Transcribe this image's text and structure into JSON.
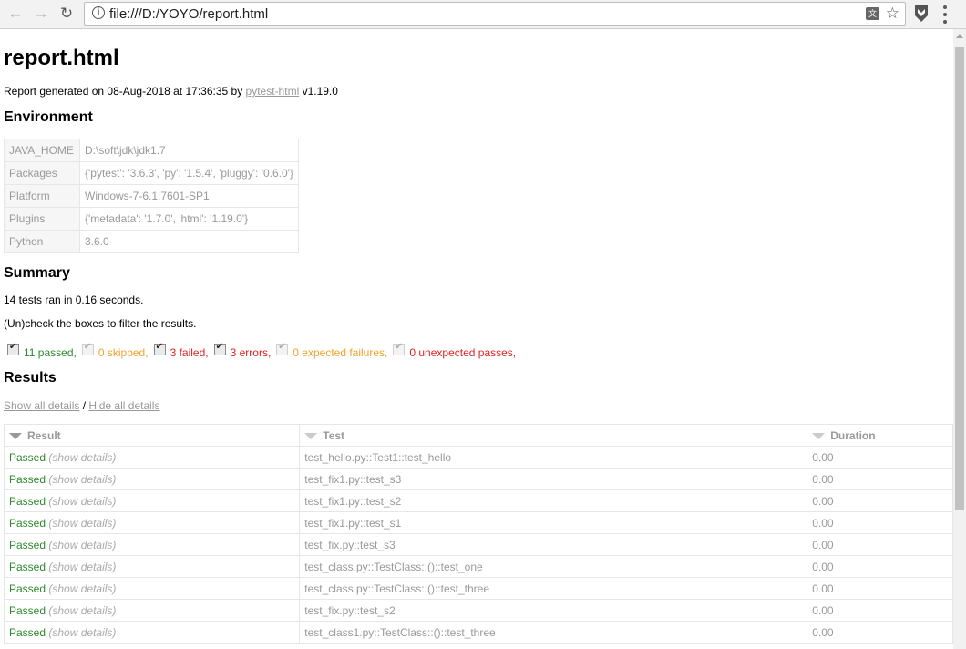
{
  "browser": {
    "url": "file:///D:/YOYO/report.html",
    "icons": [
      "back-icon",
      "forward-icon",
      "reload-icon",
      "info-icon",
      "translate-icon",
      "star-icon",
      "extension-icon",
      "menu-icon"
    ]
  },
  "report": {
    "title": "report.html",
    "generated_prefix": "Report generated on 08-Aug-2018 at 17:36:35 by",
    "generated_link": "pytest-html",
    "generated_suffix": "v1.19.0"
  },
  "environment": {
    "heading": "Environment",
    "rows": [
      {
        "key": "JAVA_HOME",
        "value": "D:\\soft\\jdk\\jdk1.7"
      },
      {
        "key": "Packages",
        "value": "{'pytest': '3.6.3', 'py': '1.5.4', 'pluggy': '0.6.0'}"
      },
      {
        "key": "Platform",
        "value": "Windows-7-6.1.7601-SP1"
      },
      {
        "key": "Plugins",
        "value": "{'metadata': '1.7.0', 'html': '1.19.0'}"
      },
      {
        "key": "Python",
        "value": "3.6.0"
      }
    ]
  },
  "summary": {
    "heading": "Summary",
    "ran": "14 tests ran in 0.16 seconds.",
    "hint": "(Un)check the boxes to filter the results.",
    "filters": [
      {
        "label": "11 passed",
        "color": "#2d8a2d",
        "enabled": true
      },
      {
        "label": "0 skipped",
        "color": "#f0a22b",
        "enabled": false
      },
      {
        "label": "3 failed",
        "color": "#dd2222",
        "enabled": true
      },
      {
        "label": "3 errors",
        "color": "#dd2222",
        "enabled": true
      },
      {
        "label": "0 expected failures",
        "color": "#f0a22b",
        "enabled": false
      },
      {
        "label": "0 unexpected passes",
        "color": "#dd2222",
        "enabled": false
      }
    ]
  },
  "results": {
    "heading": "Results",
    "show_all": "Show all details",
    "divider": "/",
    "hide_all": "Hide all details",
    "columns": [
      "Result",
      "Test",
      "Duration"
    ],
    "rows": [
      {
        "result": "Passed",
        "details": "(show details)",
        "test": "test_hello.py::Test1::test_hello",
        "duration": "0.00"
      },
      {
        "result": "Passed",
        "details": "(show details)",
        "test": "test_fix1.py::test_s3",
        "duration": "0.00"
      },
      {
        "result": "Passed",
        "details": "(show details)",
        "test": "test_fix1.py::test_s2",
        "duration": "0.00"
      },
      {
        "result": "Passed",
        "details": "(show details)",
        "test": "test_fix1.py::test_s1",
        "duration": "0.00"
      },
      {
        "result": "Passed",
        "details": "(show details)",
        "test": "test_fix.py::test_s3",
        "duration": "0.00"
      },
      {
        "result": "Passed",
        "details": "(show details)",
        "test": "test_class.py::TestClass::()::test_one",
        "duration": "0.00"
      },
      {
        "result": "Passed",
        "details": "(show details)",
        "test": "test_class.py::TestClass::()::test_three",
        "duration": "0.00"
      },
      {
        "result": "Passed",
        "details": "(show details)",
        "test": "test_fix.py::test_s2",
        "duration": "0.00"
      },
      {
        "result": "Passed",
        "details": "(show details)",
        "test": "test_class1.py::TestClass::()::test_three",
        "duration": "0.00"
      }
    ]
  }
}
